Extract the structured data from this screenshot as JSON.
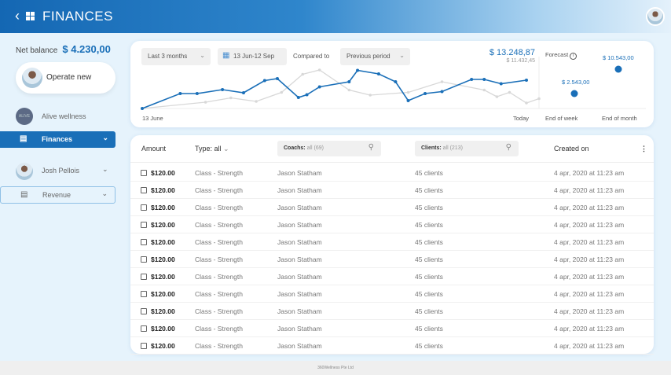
{
  "header": {
    "title": "FINANCES",
    "back_icon": "chevron-left-icon",
    "apps_icon": "grid-icon"
  },
  "sidebar": {
    "net_balance_label": "Net balance",
    "net_balance_value": "$ 4.230,00",
    "operate_label": "Operate new",
    "org_name": "Alive wellness",
    "org_logo_text": "ALIVE",
    "items": [
      {
        "label": "Finances",
        "icon": "coins-icon",
        "active": true
      },
      {
        "label": "Revenue",
        "icon": "coins-icon",
        "active": false
      }
    ],
    "user_name": "Josh Pellois"
  },
  "chart_card": {
    "range_select": "Last 3 months",
    "date_range": "13 Jun-12 Sep",
    "compared_label": "Compared to",
    "compare_select": "Previous period",
    "total": "$ 13.248,87",
    "previous_total": "$ 11.432,45",
    "x_start": "13 June",
    "x_end": "Today",
    "forecast_label": "Forecast",
    "forecast": [
      {
        "label": "End of week",
        "value": "$ 2.543,00"
      },
      {
        "label": "End of month",
        "value": "$ 10.543,00"
      }
    ]
  },
  "chart_data": {
    "type": "line",
    "x_range": [
      "06-13",
      "09-12"
    ],
    "y_unit": "relative (no axis printed)",
    "series": [
      {
        "color": "#1a6fb8",
        "points": [
          [
            "06-13",
            0
          ],
          [
            "06-22",
            38
          ],
          [
            "06-26",
            38
          ],
          [
            "07-02",
            48
          ],
          [
            "07-07",
            40
          ],
          [
            "07-12",
            71
          ],
          [
            "07-15",
            76
          ],
          [
            "07-20",
            28
          ],
          [
            "07-22",
            35
          ],
          [
            "07-25",
            55
          ],
          [
            "08-01",
            68
          ],
          [
            "08-03",
            97
          ],
          [
            "08-08",
            88
          ],
          [
            "08-12",
            68
          ],
          [
            "08-15",
            20
          ],
          [
            "08-19",
            38
          ],
          [
            "08-23",
            43
          ],
          [
            "08-30",
            74
          ],
          [
            "09-02",
            74
          ],
          [
            "09-06",
            63
          ],
          [
            "09-12",
            72
          ]
        ]
      },
      {
        "color": "#d8d8d8",
        "points": [
          [
            "06-13",
            0
          ],
          [
            "06-28",
            16
          ],
          [
            "07-04",
            27
          ],
          [
            "07-10",
            18
          ],
          [
            "07-16",
            41
          ],
          [
            "07-21",
            87
          ],
          [
            "07-25",
            98
          ],
          [
            "08-01",
            47
          ],
          [
            "08-06",
            34
          ],
          [
            "08-15",
            41
          ],
          [
            "08-23",
            68
          ],
          [
            "09-02",
            47
          ],
          [
            "09-05",
            30
          ],
          [
            "09-08",
            41
          ],
          [
            "09-12",
            14
          ],
          [
            "09-15",
            25
          ]
        ]
      }
    ],
    "forecast_points": [
      {
        "label": "End of week",
        "value": 2543.0
      },
      {
        "label": "End of month",
        "value": 10543.0
      }
    ],
    "grid": false
  },
  "table": {
    "headers": {
      "amount": "Amount",
      "type": "Type: all",
      "coachs_label": "Coachs:",
      "coachs_filter": "all (69)",
      "clients_label": "Clients:",
      "clients_filter": "all (213)",
      "created": "Created on"
    },
    "rows": [
      {
        "amount": "$120.00",
        "type": "Class - Strength",
        "coach": "Jason Statham",
        "clients": "45 clients",
        "created": "4 apr, 2020 at 11:23 am"
      },
      {
        "amount": "$120.00",
        "type": "Class - Strength",
        "coach": "Jason Statham",
        "clients": "45 clients",
        "created": "4 apr, 2020 at 11:23 am"
      },
      {
        "amount": "$120.00",
        "type": "Class - Strength",
        "coach": "Jason Statham",
        "clients": "45 clients",
        "created": "4 apr, 2020 at 11:23 am"
      },
      {
        "amount": "$120.00",
        "type": "Class - Strength",
        "coach": "Jason Statham",
        "clients": "45 clients",
        "created": "4 apr, 2020 at 11:23 am"
      },
      {
        "amount": "$120.00",
        "type": "Class - Strength",
        "coach": "Jason Statham",
        "clients": "45 clients",
        "created": "4 apr, 2020 at 11:23 am"
      },
      {
        "amount": "$120.00",
        "type": "Class - Strength",
        "coach": "Jason Statham",
        "clients": "45 clients",
        "created": "4 apr, 2020 at 11:23 am"
      },
      {
        "amount": "$120.00",
        "type": "Class - Strength",
        "coach": "Jason Statham",
        "clients": "45 clients",
        "created": "4 apr, 2020 at 11:23 am"
      },
      {
        "amount": "$120.00",
        "type": "Class - Strength",
        "coach": "Jason Statham",
        "clients": "45 clients",
        "created": "4 apr, 2020 at 11:23 am"
      },
      {
        "amount": "$120.00",
        "type": "Class - Strength",
        "coach": "Jason Statham",
        "clients": "45 clients",
        "created": "4 apr, 2020 at 11:23 am"
      },
      {
        "amount": "$120.00",
        "type": "Class - Strength",
        "coach": "Jason Statham",
        "clients": "45 clients",
        "created": "4 apr, 2020 at 11:23 am"
      },
      {
        "amount": "$120.00",
        "type": "Class - Strength",
        "coach": "Jason Statham",
        "clients": "45 clients",
        "created": "4 apr, 2020 at 11:23 am"
      }
    ]
  },
  "footer": {
    "text": "360Wellness Pte Ltd"
  }
}
